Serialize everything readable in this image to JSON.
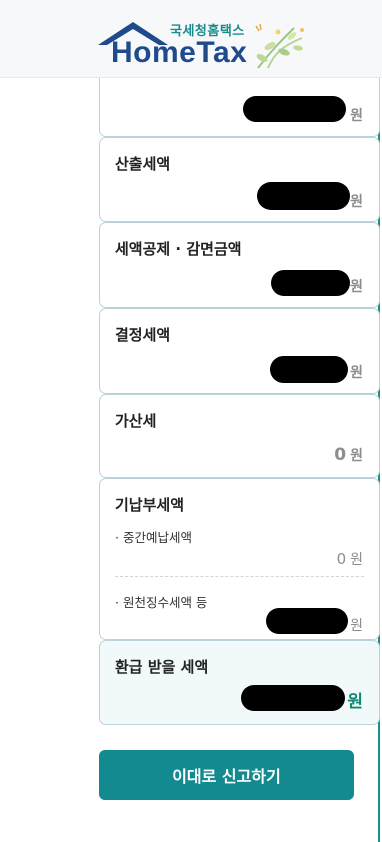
{
  "header": {
    "logo_korean": "국세청홈택스",
    "logo_english": "HomeTax"
  },
  "cards": [
    {
      "label": "",
      "unit": "원"
    },
    {
      "label": "산출세액",
      "unit": "원"
    },
    {
      "label": "세액공제 · 감면금액",
      "unit": "원"
    },
    {
      "label": "결정세액",
      "unit": "원"
    },
    {
      "label": "가산세",
      "value": "0",
      "unit": "원"
    }
  ],
  "prepaid": {
    "label": "기납부세액",
    "items": [
      {
        "label": "· 중간예납세액",
        "value": "0",
        "unit": "원"
      },
      {
        "label": "· 원천징수세액 등",
        "unit": "원"
      }
    ]
  },
  "refund": {
    "label": "환급 받을 세액",
    "unit": "원"
  },
  "submit_label": "이대로 신고하기"
}
